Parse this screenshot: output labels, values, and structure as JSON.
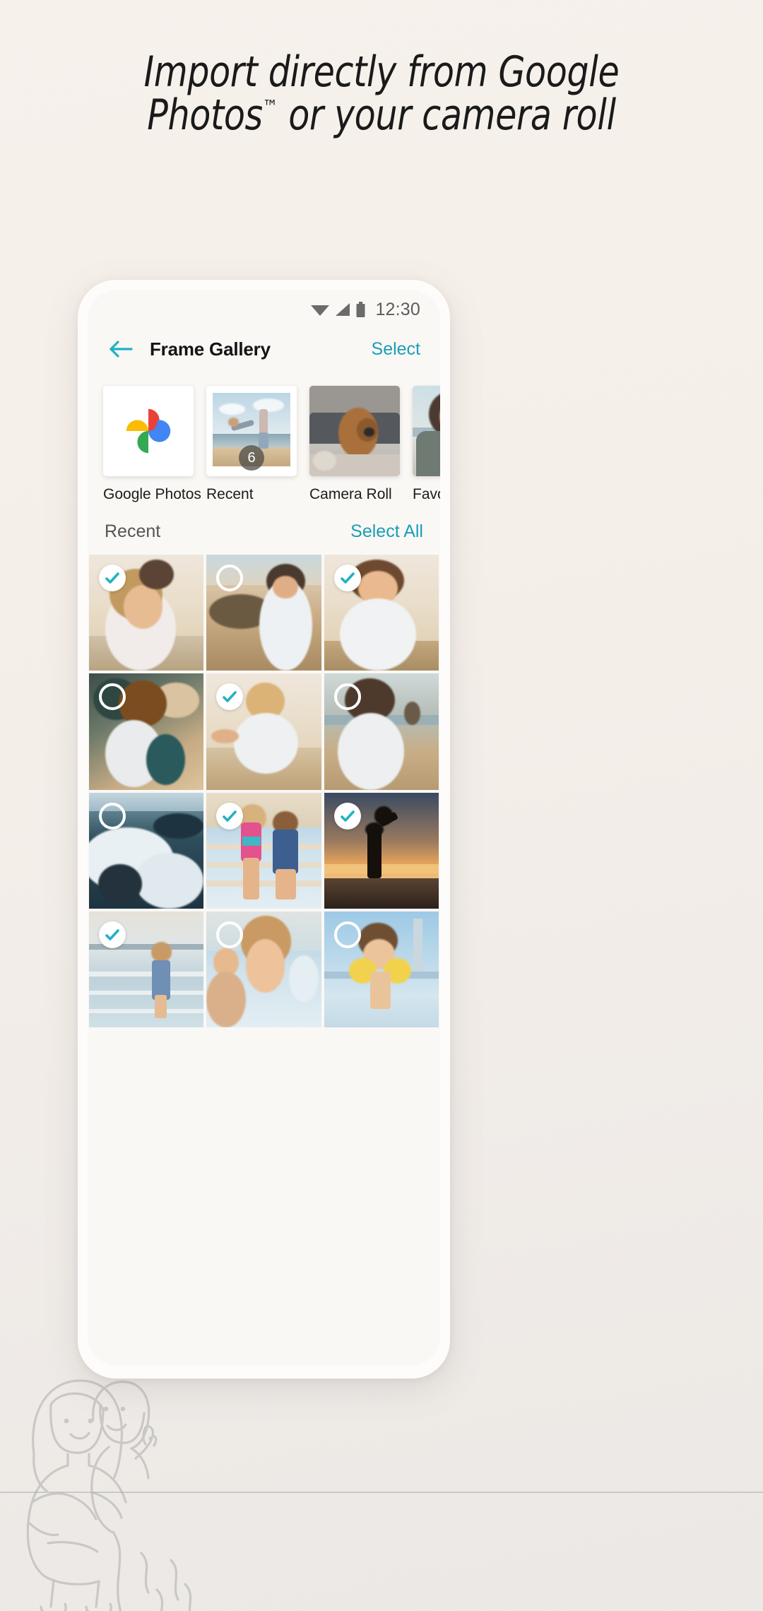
{
  "headline": {
    "line1": "Import directly from Google",
    "line2_pre": "Photos",
    "line2_tm": "™",
    "line2_post": " or your camera roll"
  },
  "colors": {
    "background": "#f5efe9",
    "accent": "#1a9eb8",
    "check": "#22b2c4",
    "text": "#141414",
    "status": "#5c5c5c"
  },
  "phone": {
    "statusbar": {
      "wifi_icon": "wifi-icon",
      "signal_icon": "signal-icon",
      "battery_icon": "battery-icon",
      "time": "12:30"
    },
    "appbar": {
      "back_icon": "back-arrow-icon",
      "title": "Frame Gallery",
      "action": "Select"
    },
    "albums": [
      {
        "label": "Google Photos",
        "type": "google-photos-logo",
        "count": null
      },
      {
        "label": "Recent",
        "type": "photo-framed",
        "count": "6"
      },
      {
        "label": "Camera Roll",
        "type": "photo",
        "count": null
      },
      {
        "label": "Favorites",
        "type": "photo",
        "count": null
      }
    ],
    "section": {
      "title": "Recent",
      "action": "Select All"
    },
    "grid": [
      {
        "id": "photo-1",
        "scene": "mom-holding-child",
        "selected": true
      },
      {
        "id": "photo-2",
        "scene": "woman-walking-beach",
        "selected": false
      },
      {
        "id": "photo-3",
        "scene": "woman-portrait-beach",
        "selected": true
      },
      {
        "id": "photo-4",
        "scene": "child-digging-sand",
        "selected": false
      },
      {
        "id": "photo-5",
        "scene": "toddler-running-sand",
        "selected": true
      },
      {
        "id": "photo-6",
        "scene": "woman-back-to-sea",
        "selected": false
      },
      {
        "id": "photo-7",
        "scene": "ocean-waves",
        "selected": false
      },
      {
        "id": "photo-8",
        "scene": "two-kids-holding-hands",
        "selected": true
      },
      {
        "id": "photo-9",
        "scene": "sunset-silhouette",
        "selected": true
      },
      {
        "id": "photo-10",
        "scene": "toddler-in-shallow-sea",
        "selected": true
      },
      {
        "id": "photo-11",
        "scene": "kids-splashing",
        "selected": false
      },
      {
        "id": "photo-12",
        "scene": "child-with-floaties",
        "selected": false
      }
    ]
  },
  "decoration": {
    "illustration": "mother-and-child-line-art"
  }
}
